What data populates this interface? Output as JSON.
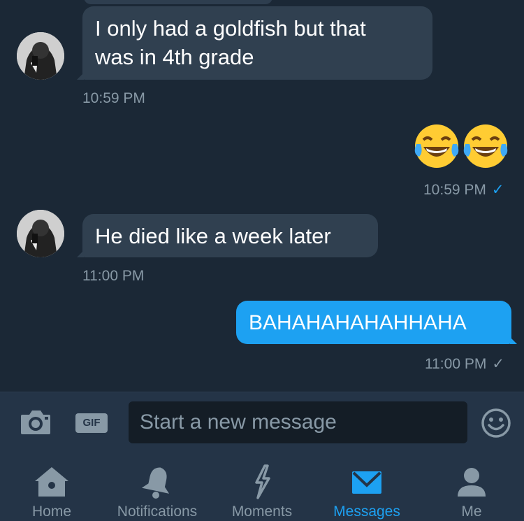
{
  "messages": [
    {
      "direction": "in",
      "text_lines": [
        "I only had a goldfish but that",
        "was in 4th grade"
      ],
      "time": "10:59 PM"
    },
    {
      "direction": "out",
      "emoji": [
        "face-with-tears-of-joy",
        "face-with-tears-of-joy"
      ],
      "time": "10:59 PM",
      "status": "read"
    },
    {
      "direction": "in",
      "text": "He died like a week later",
      "time": "11:00 PM"
    },
    {
      "direction": "out",
      "text": "BAHAHAHAHAHHAHA",
      "time": "11:00 PM",
      "status": "sent"
    }
  ],
  "composer": {
    "camera_icon": "camera-icon",
    "gif_label": "GIF",
    "placeholder": "Start a new message",
    "emoji_icon": "smiley-icon"
  },
  "tabs": [
    {
      "label": "Home",
      "icon": "home-icon",
      "active": false
    },
    {
      "label": "Notifications",
      "icon": "bell-icon",
      "active": false
    },
    {
      "label": "Moments",
      "icon": "lightning-icon",
      "active": false
    },
    {
      "label": "Messages",
      "icon": "envelope-icon",
      "active": true
    },
    {
      "label": "Me",
      "icon": "person-icon",
      "active": false
    }
  ],
  "colors": {
    "background": "#1b2836",
    "incoming_bubble": "#304050",
    "outgoing_bubble": "#1da1f2",
    "secondary_text": "#8899a6",
    "accent": "#1da1f2",
    "bar": "#243447"
  }
}
